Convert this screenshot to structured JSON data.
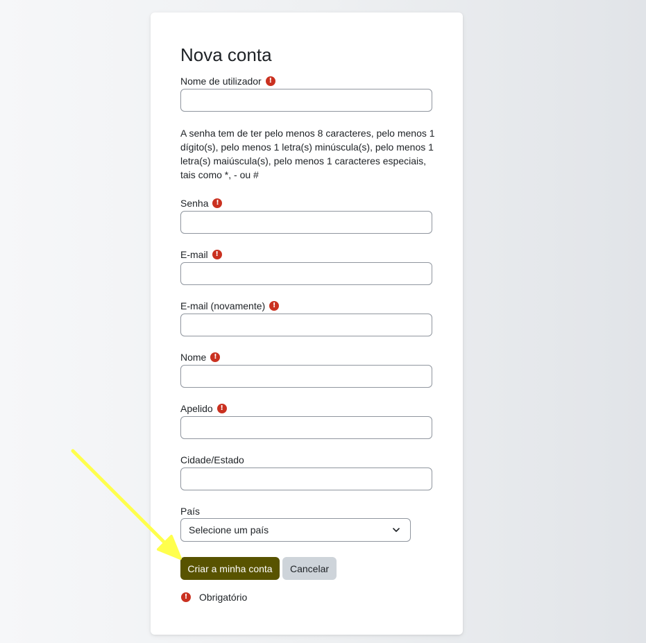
{
  "form": {
    "title": "Nova conta",
    "username_label": "Nome de utilizador",
    "password_policy": "A senha tem de ter pelo menos 8 caracteres, pelo menos 1 dígito(s), pelo menos 1 letra(s) minúscula(s), pelo menos 1 letra(s) maiúscula(s), pelo menos 1 caracteres especiais, tais como *, - ou #",
    "password_label": "Senha",
    "email_label": "E-mail",
    "email_again_label": "E-mail (novamente)",
    "firstname_label": "Nome",
    "lastname_label": "Apelido",
    "city_label": "Cidade/Estado",
    "country_label": "País",
    "country_selected": "Selecione um país",
    "values": {
      "username": "",
      "password": "",
      "email": "",
      "email_again": "",
      "firstname": "",
      "lastname": "",
      "city": ""
    }
  },
  "buttons": {
    "create": "Criar a minha conta",
    "cancel": "Cancelar"
  },
  "legend": {
    "required_text": "Obrigatório",
    "required_glyph": "!"
  },
  "colors": {
    "primary": "#585300",
    "required": "#ca3120",
    "annotation_arrow": "#ffff4d"
  },
  "icons": {
    "required": "exclamation-circle-icon",
    "select": "chevron-down-icon",
    "annotation": "arrow-icon"
  }
}
